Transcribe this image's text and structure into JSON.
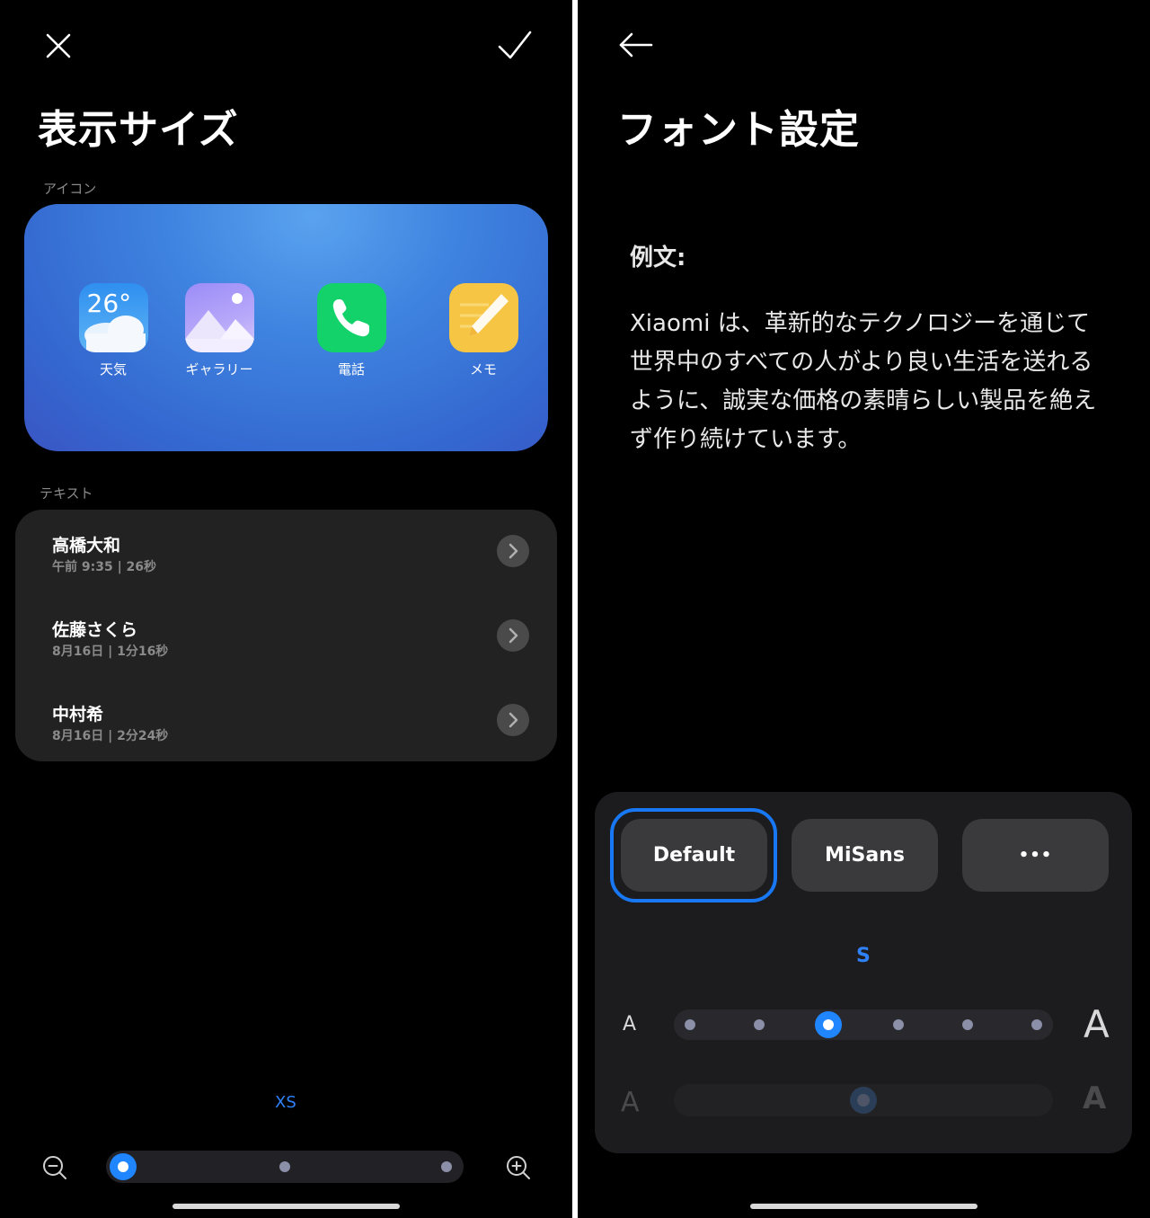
{
  "left": {
    "title": "表示サイズ",
    "icons_section_label": "アイコン",
    "apps": [
      {
        "label": "天気",
        "icon": "weather-icon",
        "temperature": "26°"
      },
      {
        "label": "ギャラリー",
        "icon": "gallery-icon"
      },
      {
        "label": "電話",
        "icon": "phone-icon"
      },
      {
        "label": "メモ",
        "icon": "notes-icon"
      }
    ],
    "text_section_label": "テキスト",
    "messages": [
      {
        "name": "高橋大和",
        "meta": "午前 9:35 | 26秒"
      },
      {
        "name": "佐藤さくら",
        "meta": "8月16日 | 1分16秒"
      },
      {
        "name": "中村希",
        "meta": "8月16日 | 2分24秒"
      }
    ],
    "size_value": "XS",
    "size_slider": {
      "steps": 3,
      "selected_index": 0
    }
  },
  "right": {
    "title": "フォント設定",
    "sample_label": "例文:",
    "sample_text": "Xiaomi は、革新的なテクノロジーを通じて世界中のすべての人がより良い生活を送れるように、誠実な価格の素晴らしい製品を絶えず作り続けています。",
    "fonts": [
      {
        "label": "Default",
        "selected": true
      },
      {
        "label": "MiSans",
        "selected": false
      },
      {
        "label": "•••",
        "selected": false
      }
    ],
    "size_value": "S",
    "size_small_glyph": "A",
    "size_large_glyph": "A",
    "size_slider": {
      "steps": 6,
      "selected_index": 2
    },
    "weight_small_glyph": "A",
    "weight_large_glyph": "A",
    "weight_slider": {
      "value": 0.5,
      "disabled": true
    }
  },
  "colors": {
    "accent": "#1f86ff",
    "background": "#000000",
    "card": "#222222"
  }
}
